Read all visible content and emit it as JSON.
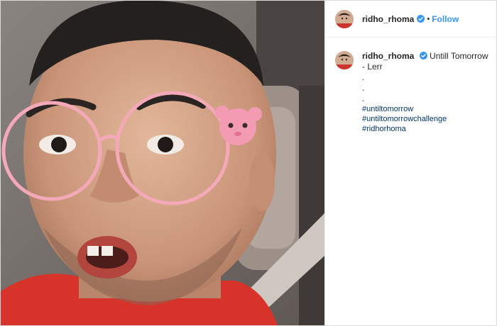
{
  "post": {
    "username": "ridho_rhoma",
    "separator": "•",
    "follow_label": "Follow"
  },
  "caption": {
    "username": "ridho_rhoma",
    "text": "Untill Tomorrow - Lerr",
    "dots": [
      ".",
      ".",
      "."
    ],
    "hashtags": [
      "#untiltomorrow",
      "#untiltomorrowchallenge",
      "#ridhorhoma"
    ]
  },
  "colors": {
    "link": "#3897f0",
    "hashtag": "#003569",
    "verified": "#3897f0"
  }
}
